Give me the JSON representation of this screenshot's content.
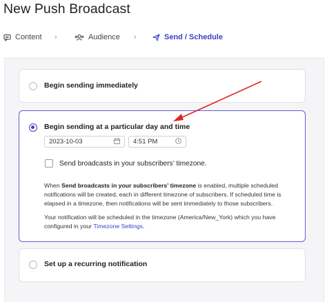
{
  "page": {
    "title": "New Push Broadcast"
  },
  "steps": [
    {
      "label": "Content",
      "icon": "content-icon"
    },
    {
      "label": "Audience",
      "icon": "audience-icon"
    },
    {
      "label": "Send / Schedule",
      "icon": "send-icon",
      "active": true
    }
  ],
  "options": {
    "immediate": {
      "label": "Begin sending immediately",
      "selected": false
    },
    "scheduled": {
      "label": "Begin sending at a particular day and time",
      "selected": true,
      "date_value": "2023-10-03",
      "time_value": "4:51 PM",
      "timezone_checkbox_label": "Send broadcasts in your subscribers’ timezone.",
      "timezone_checkbox_checked": false,
      "note1_prefix": "When ",
      "note1_bold": "Send broadcasts in your subscribers’ timezone",
      "note1_suffix": " is enabled, multiple scheduled notifications will be created, each in different timezone of subscribers. If scheduled time is elapsed in a timezone, then notifications will be sent immediately to those subscribers.",
      "note2_prefix": "Your notification will be scheduled in the timezone (America/New_York) which you have configured in your ",
      "note2_link": "Timezone Settings",
      "note2_suffix": "."
    },
    "recurring": {
      "label": "Set up a recurring notification",
      "selected": false
    }
  },
  "colors": {
    "accent": "#3b40c8",
    "annotation_arrow": "#e02424"
  }
}
